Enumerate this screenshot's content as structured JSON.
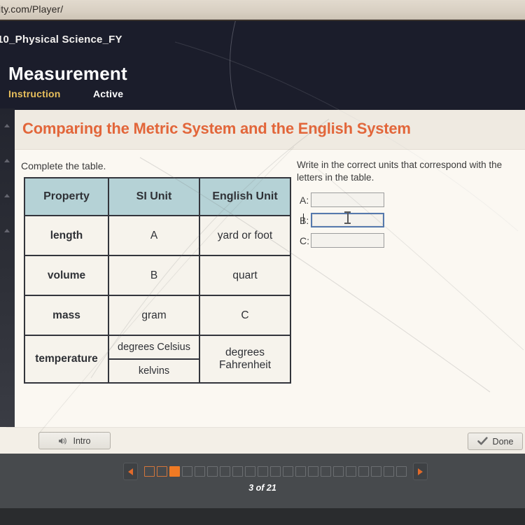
{
  "browser": {
    "url": "ity.com/Player/"
  },
  "app_header": {
    "course_name": "10_Physical Science_FY",
    "lesson_title": "Measurement",
    "tab_instruction": "Instruction",
    "tab_active": "Active"
  },
  "content": {
    "page_title": "Comparing the Metric System and the English System",
    "title_color": "#e2663a",
    "prompt_left": "Complete the table.",
    "prompt_right": "Write in the correct units that correspond with the letters in the table."
  },
  "table": {
    "headers": [
      "Property",
      "SI Unit",
      "English Unit"
    ],
    "header_bg": "#b5d2d6",
    "blank_color": "#d4713c",
    "rows": [
      {
        "property": "length",
        "si_unit": "A",
        "si_is_blank": true,
        "english_unit": "yard or foot",
        "english_is_blank": false
      },
      {
        "property": "volume",
        "si_unit": "B",
        "si_is_blank": true,
        "english_unit": "quart",
        "english_is_blank": false
      },
      {
        "property": "mass",
        "si_unit": "gram",
        "si_is_blank": false,
        "english_unit": "C",
        "english_is_blank": true
      }
    ],
    "temperature_row": {
      "property": "temperature",
      "si_unit_line1": "degrees Celsius",
      "si_unit_line2": "kelvins",
      "english_unit_line1": "degrees",
      "english_unit_line2": "Fahrenheit"
    }
  },
  "answers": {
    "fields": [
      {
        "label": "A:",
        "value": "",
        "focused": false
      },
      {
        "label": "B:",
        "value": "",
        "focused": true
      },
      {
        "label": "C:",
        "value": "",
        "focused": false
      }
    ]
  },
  "buttons": {
    "intro_label": "Intro",
    "intro_icon": "speaker-icon",
    "done_label": "Done",
    "done_icon": "checkmark-icon"
  },
  "footer": {
    "prev_icon": "chevron-left-icon",
    "next_icon": "chevron-right-icon",
    "page_counter": "3 of 21",
    "total_pages": 21,
    "current_page": 3,
    "visited_pages": 2,
    "current_color": "#ef7a24",
    "visited_color": "#d2763c"
  }
}
